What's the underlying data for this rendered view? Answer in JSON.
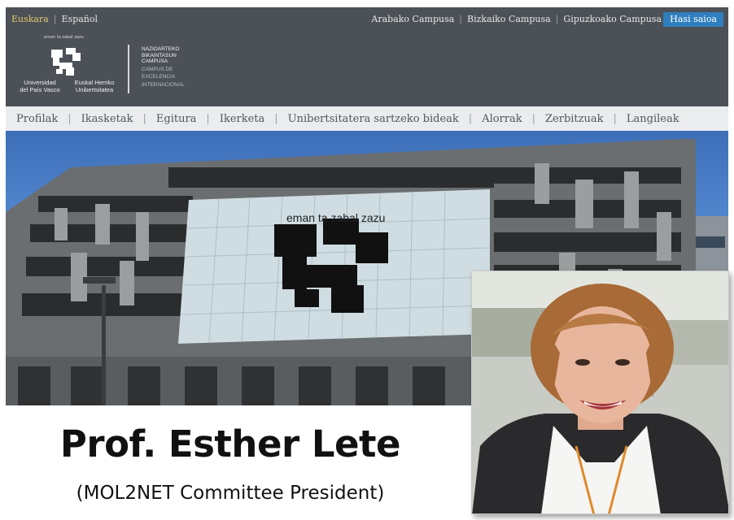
{
  "topbar": {
    "lang_active": "Euskara",
    "lang_other": "Español",
    "campus_links": [
      "Arabako Campusa",
      "Bizkaiko Campusa",
      "Gipuzkoako Campusa"
    ],
    "login_label": "Hasi saioa"
  },
  "header": {
    "logo_small_text": "eman ta zabal zazu",
    "university_es_line1": "Universidad",
    "university_es_line2": "del País Vasco",
    "university_eu_line1": "Euskal Herriko",
    "university_eu_line2": "Unibertsitatea",
    "campus_eu": [
      "NAZIOARTEKO",
      "BIKAINTASUN",
      "CAMPUSA"
    ],
    "campus_es": [
      "CAMPUS DE",
      "EXCELENCIA",
      "INTERNACIONAL"
    ]
  },
  "nav": {
    "items": [
      "Profilak",
      "Ikasketak",
      "Egitura",
      "Ikerketa",
      "Unibertsitatera sartzeko bideak",
      "Alorrak",
      "Zerbitzuak",
      "Langileak"
    ]
  },
  "hero": {
    "facade_motto": "eman ta zabal zazu"
  },
  "main": {
    "title": "Prof. Esther Lete",
    "subtitle": "(MOL2NET Committee President)"
  },
  "colors": {
    "topbar_bg": "#4c5157",
    "lang_active": "#e0c46a",
    "login_button": "#2f7fbf",
    "nav_bg": "#eaecee",
    "sky": "#5a8fd6"
  }
}
